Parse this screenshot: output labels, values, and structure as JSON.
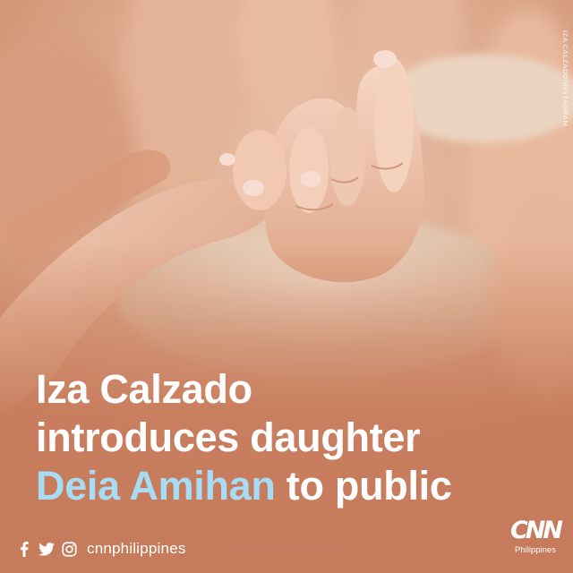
{
  "photo": {
    "subject": "adult-finger-held-by-baby-hand"
  },
  "credit": {
    "text": "IZA CALZADO/INSTAGRAM"
  },
  "headline": {
    "line1": "Iza Calzado",
    "line2": "introduces daughter",
    "line3_highlight": "Deia Amihan",
    "line3_rest": " to public",
    "highlight_color": "#a7dcf7"
  },
  "social": {
    "icons": [
      "facebook-icon",
      "twitter-icon",
      "instagram-icon"
    ],
    "handle": "cnnphilippines"
  },
  "logo": {
    "mark": "CNN",
    "sub": "Philippines"
  },
  "colors": {
    "overlay": "#c67b5b",
    "text": "#ffffff"
  }
}
